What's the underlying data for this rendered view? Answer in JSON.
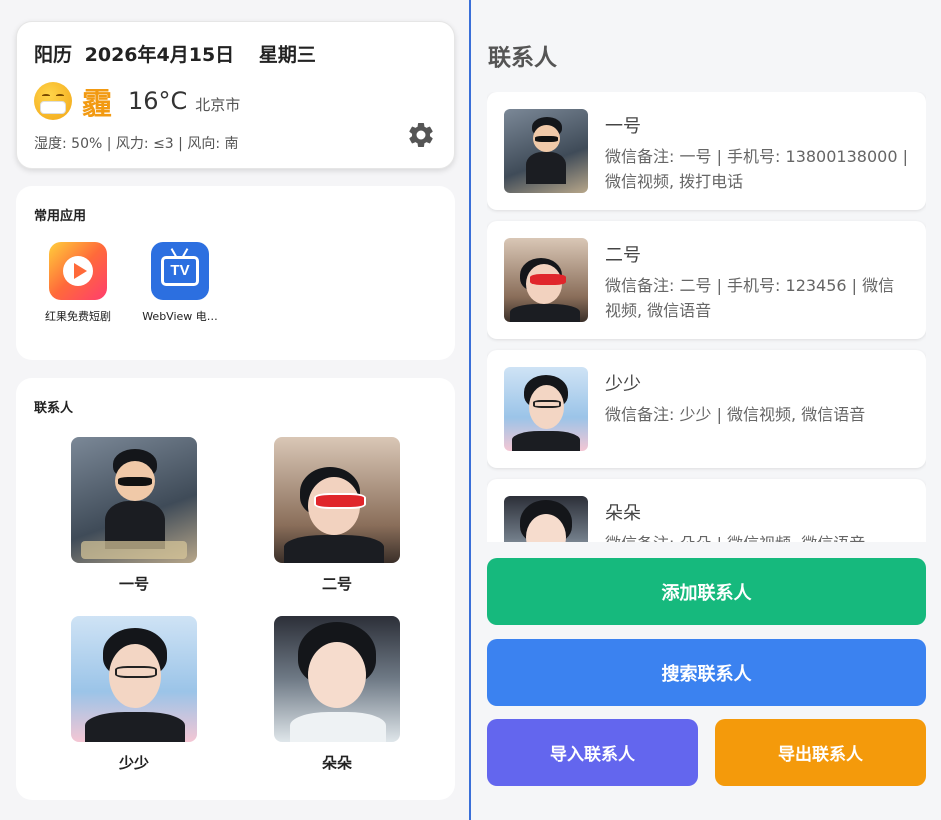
{
  "weather": {
    "calendar": "阳历",
    "date": "2026年4月15日",
    "weekday": "星期三",
    "condition_char": "霾",
    "condition_icon": "masked-face-icon",
    "temperature": "16°C",
    "city": "北京市",
    "stats": "湿度: 50% | 风力: ≤3 | 风向: 南"
  },
  "apps": {
    "title": "常用应用",
    "items": [
      {
        "label": "红果免费短剧",
        "icon": "hongguo-play-icon"
      },
      {
        "label": "WebView 电…",
        "icon": "tv-icon"
      }
    ]
  },
  "contacts_grid": {
    "title": "联系人",
    "items": [
      {
        "name": "一号"
      },
      {
        "name": "二号"
      },
      {
        "name": "少少"
      },
      {
        "name": "朵朵"
      }
    ]
  },
  "contacts_list": {
    "heading": "联系人",
    "items": [
      {
        "name": "一号",
        "desc": "微信备注: 一号 | 手机号: 13800138000 | 微信视频, 拨打电话"
      },
      {
        "name": "二号",
        "desc": "微信备注: 二号 | 手机号: 123456 | 微信视频, 微信语音"
      },
      {
        "name": "少少",
        "desc": "微信备注: 少少 | 微信视频, 微信语音"
      },
      {
        "name": "朵朵",
        "desc": "微信备注: 朵朵 | 微信视频, 微信语音"
      }
    ]
  },
  "actions": {
    "add": "添加联系人",
    "search": "搜索联系人",
    "import": "导入联系人",
    "export": "导出联系人"
  },
  "colors": {
    "add": "#16b97d",
    "search": "#3b82f0",
    "import": "#6366ee",
    "export": "#f49a0b",
    "divider": "#3a6fd8"
  }
}
